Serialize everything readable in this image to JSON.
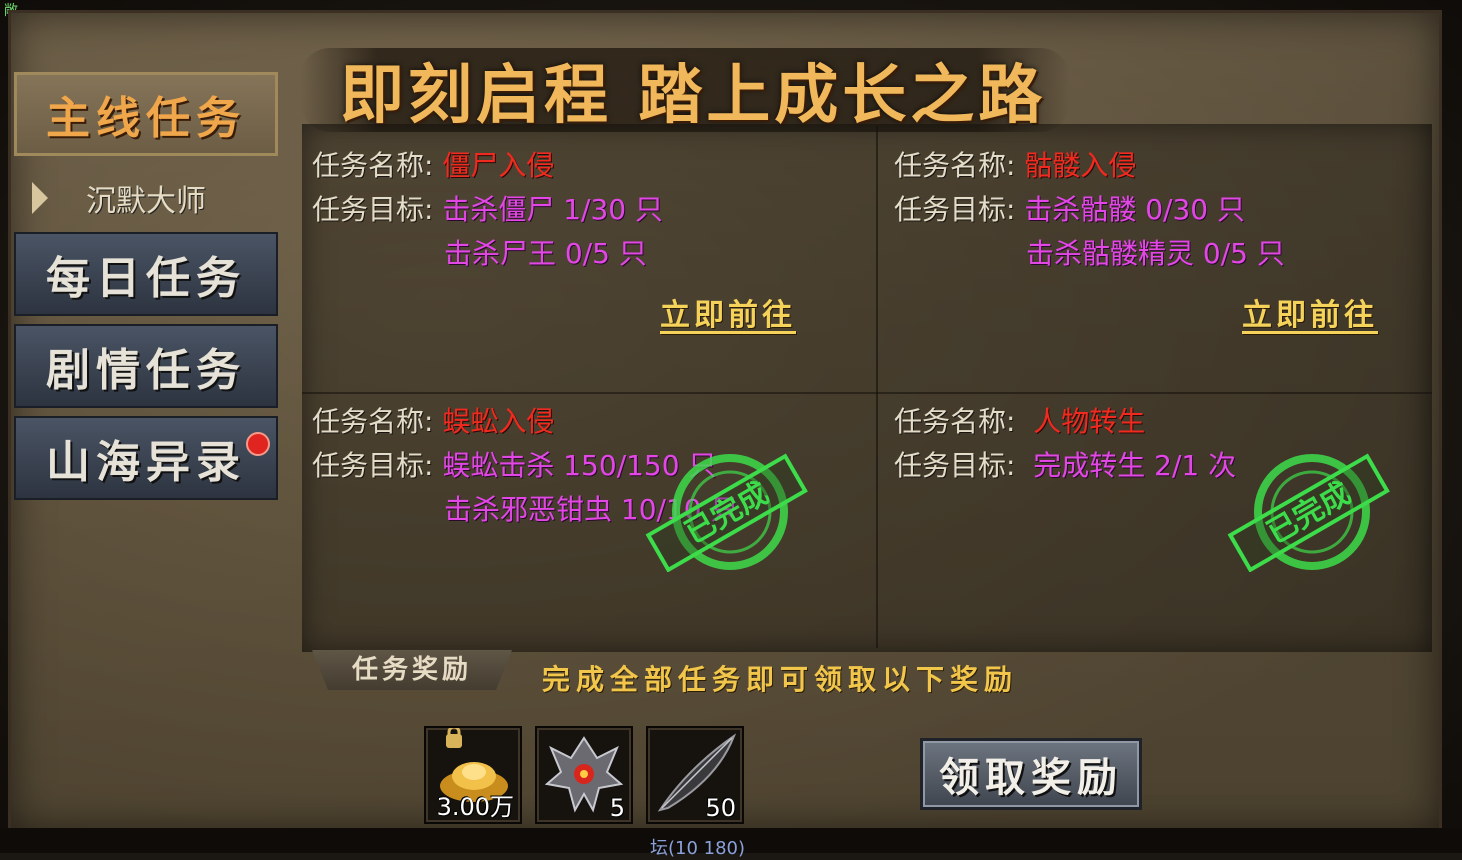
{
  "title": "即刻启程  踏上成长之路",
  "corner_label": "敞",
  "sidebar": {
    "items": [
      {
        "label": "主线任务"
      },
      {
        "label": "沉默大师"
      },
      {
        "label": "每日任务"
      },
      {
        "label": "剧情任务"
      },
      {
        "label": "山海异录"
      }
    ]
  },
  "labels": {
    "name": "任务名称:",
    "goal": "任务目标:"
  },
  "tasks": [
    {
      "name": "僵尸入侵",
      "goals": [
        "击杀僵尸 1/30 只",
        "击杀尸王 0/5 只"
      ],
      "action": "立即前往"
    },
    {
      "name": "骷髅入侵",
      "goals": [
        "击杀骷髅 0/30 只",
        "击杀骷髅精灵 0/5 只"
      ],
      "action": "立即前往"
    },
    {
      "name": "蜈蚣入侵",
      "goals": [
        "蜈蚣击杀 150/150 只",
        "击杀邪恶钳虫 10/10 只"
      ],
      "stamp": "已完成"
    },
    {
      "name": "人物转生",
      "goals": [
        "完成转生 2/1 次"
      ],
      "stamp": "已完成"
    }
  ],
  "reward": {
    "tab_label": "任务奖励",
    "note": "完成全部任务即可领取以下奖励",
    "items": [
      {
        "icon": "gold-ingot-icon",
        "count": "3.00万"
      },
      {
        "icon": "demon-mask-icon",
        "count": "5"
      },
      {
        "icon": "feather-icon",
        "count": "50"
      }
    ],
    "claim_label": "领取奖励"
  },
  "bottom_text": "坛(10 180)"
}
